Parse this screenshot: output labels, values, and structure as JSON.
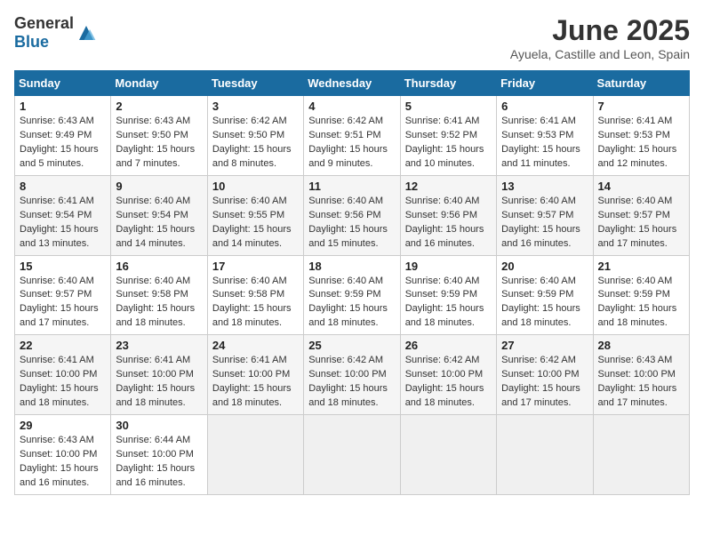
{
  "header": {
    "logo_general": "General",
    "logo_blue": "Blue",
    "month_title": "June 2025",
    "location": "Ayuela, Castille and Leon, Spain"
  },
  "days_of_week": [
    "Sunday",
    "Monday",
    "Tuesday",
    "Wednesday",
    "Thursday",
    "Friday",
    "Saturday"
  ],
  "weeks": [
    [
      {
        "day": "1",
        "sunrise": "6:43 AM",
        "sunset": "9:49 PM",
        "daylight": "15 hours and 5 minutes."
      },
      {
        "day": "2",
        "sunrise": "6:43 AM",
        "sunset": "9:50 PM",
        "daylight": "15 hours and 7 minutes."
      },
      {
        "day": "3",
        "sunrise": "6:42 AM",
        "sunset": "9:50 PM",
        "daylight": "15 hours and 8 minutes."
      },
      {
        "day": "4",
        "sunrise": "6:42 AM",
        "sunset": "9:51 PM",
        "daylight": "15 hours and 9 minutes."
      },
      {
        "day": "5",
        "sunrise": "6:41 AM",
        "sunset": "9:52 PM",
        "daylight": "15 hours and 10 minutes."
      },
      {
        "day": "6",
        "sunrise": "6:41 AM",
        "sunset": "9:53 PM",
        "daylight": "15 hours and 11 minutes."
      },
      {
        "day": "7",
        "sunrise": "6:41 AM",
        "sunset": "9:53 PM",
        "daylight": "15 hours and 12 minutes."
      }
    ],
    [
      {
        "day": "8",
        "sunrise": "6:41 AM",
        "sunset": "9:54 PM",
        "daylight": "15 hours and 13 minutes."
      },
      {
        "day": "9",
        "sunrise": "6:40 AM",
        "sunset": "9:54 PM",
        "daylight": "15 hours and 14 minutes."
      },
      {
        "day": "10",
        "sunrise": "6:40 AM",
        "sunset": "9:55 PM",
        "daylight": "15 hours and 14 minutes."
      },
      {
        "day": "11",
        "sunrise": "6:40 AM",
        "sunset": "9:56 PM",
        "daylight": "15 hours and 15 minutes."
      },
      {
        "day": "12",
        "sunrise": "6:40 AM",
        "sunset": "9:56 PM",
        "daylight": "15 hours and 16 minutes."
      },
      {
        "day": "13",
        "sunrise": "6:40 AM",
        "sunset": "9:57 PM",
        "daylight": "15 hours and 16 minutes."
      },
      {
        "day": "14",
        "sunrise": "6:40 AM",
        "sunset": "9:57 PM",
        "daylight": "15 hours and 17 minutes."
      }
    ],
    [
      {
        "day": "15",
        "sunrise": "6:40 AM",
        "sunset": "9:57 PM",
        "daylight": "15 hours and 17 minutes."
      },
      {
        "day": "16",
        "sunrise": "6:40 AM",
        "sunset": "9:58 PM",
        "daylight": "15 hours and 18 minutes."
      },
      {
        "day": "17",
        "sunrise": "6:40 AM",
        "sunset": "9:58 PM",
        "daylight": "15 hours and 18 minutes."
      },
      {
        "day": "18",
        "sunrise": "6:40 AM",
        "sunset": "9:59 PM",
        "daylight": "15 hours and 18 minutes."
      },
      {
        "day": "19",
        "sunrise": "6:40 AM",
        "sunset": "9:59 PM",
        "daylight": "15 hours and 18 minutes."
      },
      {
        "day": "20",
        "sunrise": "6:40 AM",
        "sunset": "9:59 PM",
        "daylight": "15 hours and 18 minutes."
      },
      {
        "day": "21",
        "sunrise": "6:40 AM",
        "sunset": "9:59 PM",
        "daylight": "15 hours and 18 minutes."
      }
    ],
    [
      {
        "day": "22",
        "sunrise": "6:41 AM",
        "sunset": "10:00 PM",
        "daylight": "15 hours and 18 minutes."
      },
      {
        "day": "23",
        "sunrise": "6:41 AM",
        "sunset": "10:00 PM",
        "daylight": "15 hours and 18 minutes."
      },
      {
        "day": "24",
        "sunrise": "6:41 AM",
        "sunset": "10:00 PM",
        "daylight": "15 hours and 18 minutes."
      },
      {
        "day": "25",
        "sunrise": "6:42 AM",
        "sunset": "10:00 PM",
        "daylight": "15 hours and 18 minutes."
      },
      {
        "day": "26",
        "sunrise": "6:42 AM",
        "sunset": "10:00 PM",
        "daylight": "15 hours and 18 minutes."
      },
      {
        "day": "27",
        "sunrise": "6:42 AM",
        "sunset": "10:00 PM",
        "daylight": "15 hours and 17 minutes."
      },
      {
        "day": "28",
        "sunrise": "6:43 AM",
        "sunset": "10:00 PM",
        "daylight": "15 hours and 17 minutes."
      }
    ],
    [
      {
        "day": "29",
        "sunrise": "6:43 AM",
        "sunset": "10:00 PM",
        "daylight": "15 hours and 16 minutes."
      },
      {
        "day": "30",
        "sunrise": "6:44 AM",
        "sunset": "10:00 PM",
        "daylight": "15 hours and 16 minutes."
      },
      null,
      null,
      null,
      null,
      null
    ]
  ]
}
